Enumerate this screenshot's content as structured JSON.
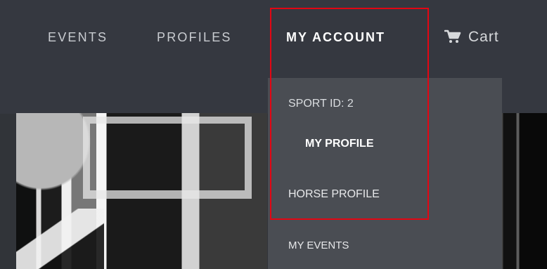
{
  "nav": {
    "items": [
      {
        "label": "EVENTS",
        "name": "nav-events"
      },
      {
        "label": "PROFILES",
        "name": "nav-profiles"
      },
      {
        "label": "MY ACCOUNT",
        "name": "nav-my-account"
      }
    ],
    "cart_label": "Cart",
    "cart_icon": "shopping-cart-icon"
  },
  "dropdown": {
    "items": [
      {
        "label": "SPORT ID: 2"
      },
      {
        "label": "MY PROFILE"
      },
      {
        "label": "HORSE PROFILE"
      },
      {
        "label": "MY EVENTS"
      }
    ]
  },
  "colors": {
    "nav_background": "#353840",
    "dropdown_background": "#4a4d53",
    "highlight_border": "#e30613"
  }
}
